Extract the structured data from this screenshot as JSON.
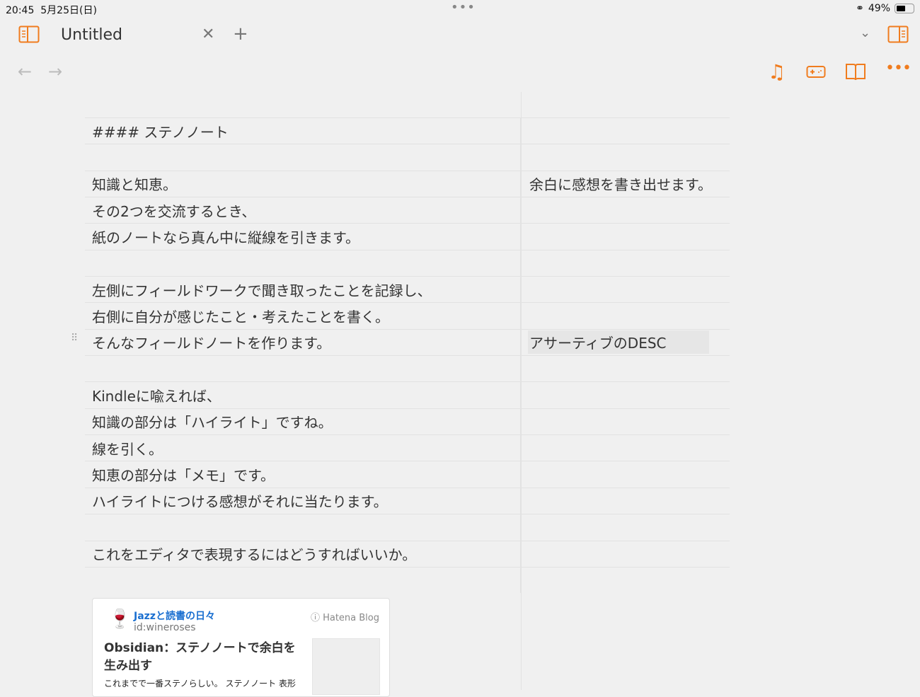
{
  "status": {
    "time": "20:45",
    "date": "5月25日(日)",
    "dots": "•••",
    "battery": "49%"
  },
  "tab": {
    "title": "Untitled"
  },
  "rows": [
    {
      "left": "#### ステノノート",
      "right": ""
    },
    {
      "left": "",
      "right": ""
    },
    {
      "left": "知識と知恵。",
      "right": "余白に感想を書き出せます。"
    },
    {
      "left": "その2つを交流するとき、",
      "right": ""
    },
    {
      "left": "紙のノートなら真ん中に縦線を引きます。",
      "right": ""
    },
    {
      "left": "",
      "right": ""
    },
    {
      "left": "左側にフィールドワークで聞き取ったことを記録し、",
      "right": ""
    },
    {
      "left": "右側に自分が感じたこと・考えたことを書く。",
      "right": ""
    },
    {
      "left": "そんなフィールドノートを作ります。",
      "right": "アサーティブのDESC"
    },
    {
      "left": "",
      "right": ""
    },
    {
      "left": "Kindleに喩えれば、",
      "right": ""
    },
    {
      "left": "知識の部分は「ハイライト」ですね。",
      "right": ""
    },
    {
      "left": "線を引く。",
      "right": ""
    },
    {
      "left": "知恵の部分は「メモ」です。",
      "right": ""
    },
    {
      "left": "ハイライトにつける感想がそれに当たります。",
      "right": ""
    },
    {
      "left": "",
      "right": ""
    },
    {
      "left": "これをエディタで表現するにはどうすればいいか。",
      "right": ""
    },
    {
      "left": "",
      "right": ""
    }
  ],
  "card": {
    "blog": "Jazzと読書の日々",
    "id": "id:wineroses",
    "brand": "Hatena Blog",
    "title": "Obsidian：ステノノートで余白を生み出す",
    "desc": "これまでで一番ステノらしい。 ステノノート 表形"
  },
  "colors": {
    "accent": "#f07c1e"
  }
}
